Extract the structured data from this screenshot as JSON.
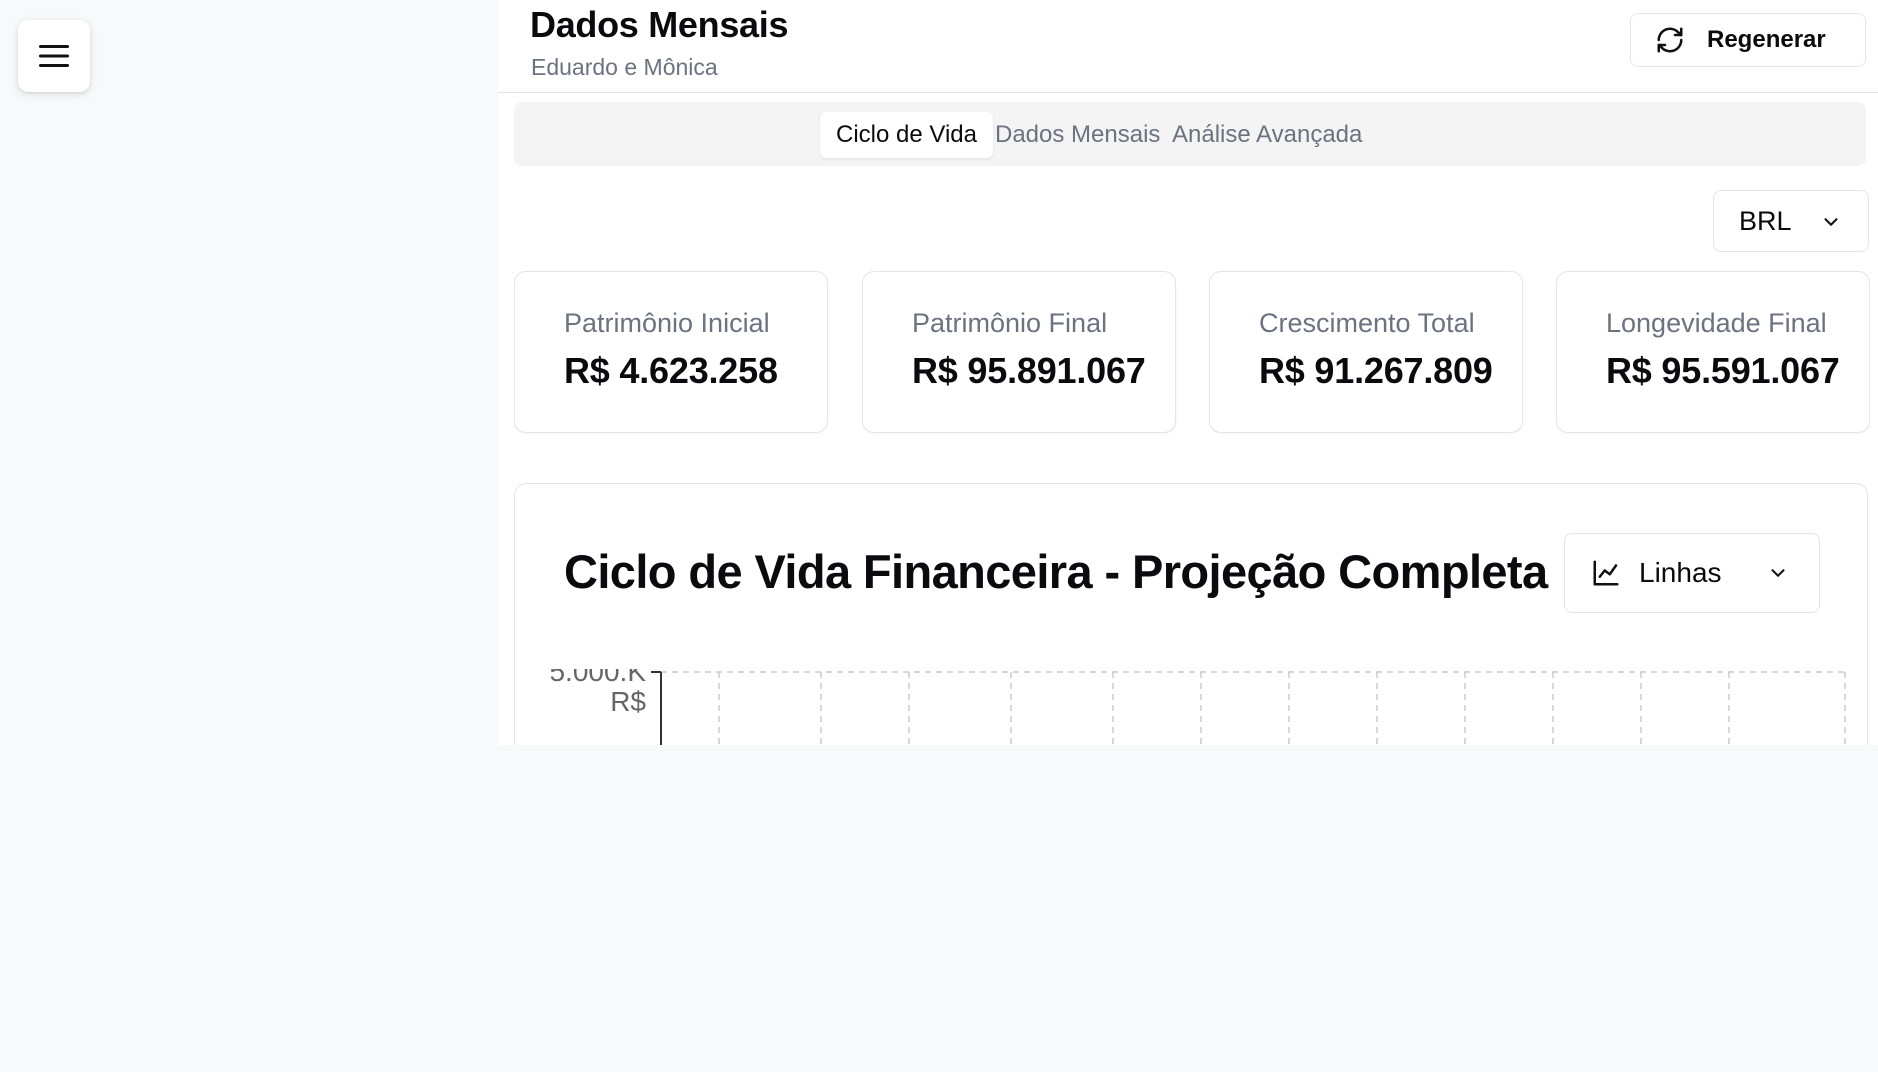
{
  "header": {
    "title": "Dados Mensais",
    "subtitle": "Eduardo e Mônica",
    "regenerate_label": "Regenerar"
  },
  "tabs": [
    {
      "label": "Ciclo de Vida",
      "active": true
    },
    {
      "label": "Dados Mensais",
      "active": false
    },
    {
      "label": "Análise Avançada",
      "active": false
    }
  ],
  "currency": {
    "selected": "BRL"
  },
  "stats": [
    {
      "label": "Patrimônio Inicial",
      "value": "R$ 4.623.258"
    },
    {
      "label": "Patrimônio Final",
      "value": "R$ 95.891.067"
    },
    {
      "label": "Crescimento Total",
      "value": "R$ 91.267.809"
    },
    {
      "label": "Longevidade Final",
      "value": "R$ 95.591.067"
    }
  ],
  "chart": {
    "title": "Ciclo de Vida Financeira - Projeção Completa",
    "type_selected": "Linhas",
    "y_tick_top": "5.000.K",
    "y_tick_top_unit": "R$"
  },
  "icons": {
    "menu": "hamburger-menu-icon",
    "regenerate": "refresh-icon",
    "chart_type": "line-chart-icon",
    "dropdown": "chevron-down-icon"
  },
  "colors": {
    "page_background": "#f8f9fb",
    "border": "#e4e5e8",
    "muted_text": "#6b7280",
    "accent": "#2563eb"
  }
}
